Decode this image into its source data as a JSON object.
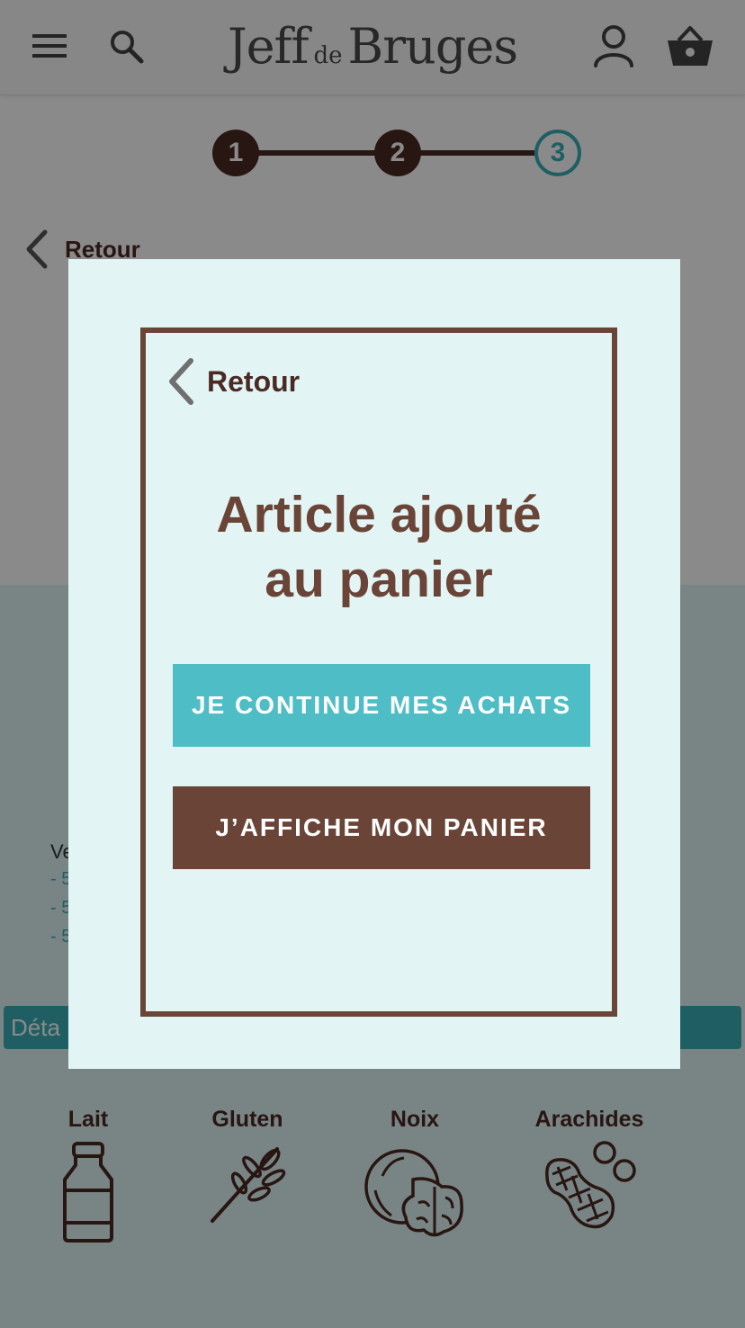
{
  "header": {
    "logo_part1": "Jeff",
    "logo_part2": "de",
    "logo_part3": "Bruges"
  },
  "stepper": {
    "steps": [
      "1",
      "2",
      "3"
    ],
    "active_step": 3
  },
  "page": {
    "back_label": "Retour",
    "partial_text": "Ve",
    "dash_items": [
      "- 5",
      "- 5",
      "- 5"
    ],
    "details_label": "Déta"
  },
  "allergens": [
    {
      "label": "Lait",
      "icon": "milk-bottle-icon"
    },
    {
      "label": "Gluten",
      "icon": "wheat-icon"
    },
    {
      "label": "Noix",
      "icon": "walnut-icon"
    },
    {
      "label": "Arachides",
      "icon": "peanut-icon"
    }
  ],
  "modal": {
    "back_label": "Retour",
    "title_line1": "Article ajouté",
    "title_line2": "au panier",
    "continue_label": "JE CONTINUE MES ACHATS",
    "cart_label": "J’AFFICHE MON PANIER"
  },
  "colors": {
    "brand_brown": "#6a4537",
    "dark_brown": "#4a2a22",
    "teal": "#3ab0ba",
    "button_teal": "#4ebdc6",
    "modal_bg": "#e2f4f4"
  }
}
